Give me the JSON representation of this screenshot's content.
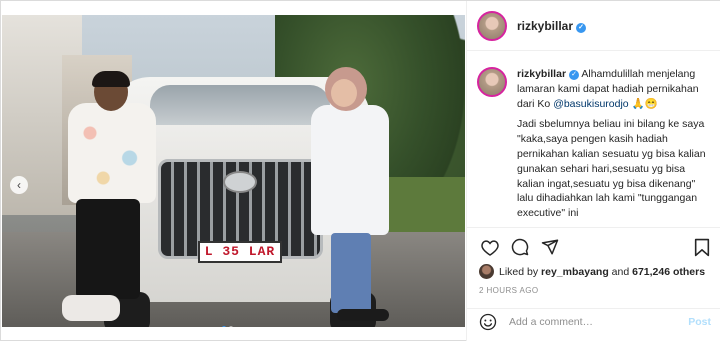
{
  "photo": {
    "plate_text": "L 35 LAR",
    "carousel_dots": 2,
    "active_dot": 0
  },
  "post": {
    "username": "rizkybillar",
    "verified": true,
    "caption": {
      "line1_before": "Alhamdulillah menjelang lamaran kami dapat hadiah pernikahan dari Ko ",
      "mention": "@basukisurodjo",
      "emojis": "🙏😁",
      "paragraph2": "Jadi sbelumnya beliau ini bilang ke saya \"kaka,saya pengen kasih hadiah pernikahan kalian sesuatu yg bisa kalian gunakan sehari hari,sesuatu yg bisa kalian ingat,sesuatu yg bisa dikenang\" lalu dihadiahkan lah kami \"tunggangan executive\" ini"
    },
    "likes": {
      "prefix": "Liked by",
      "user": "rey_mbayang",
      "connector": "and",
      "others": "671,246 others"
    },
    "timestamp": "2 HOURS AGO",
    "comment": {
      "placeholder": "Add a comment…",
      "post_label": "Post"
    }
  },
  "icons": {
    "like": "heart-icon",
    "comment": "comment-icon",
    "share": "send-icon",
    "save": "bookmark-icon",
    "emoji": "smiley-icon",
    "prev": "chevron-left-icon",
    "verified": "verified-badge-icon"
  },
  "colors": {
    "verified": "#3897f0",
    "mention": "#00376b",
    "post_button": "#b2dffc",
    "timestamp": "#8e8e8e",
    "plate_text": "#c0172b"
  }
}
